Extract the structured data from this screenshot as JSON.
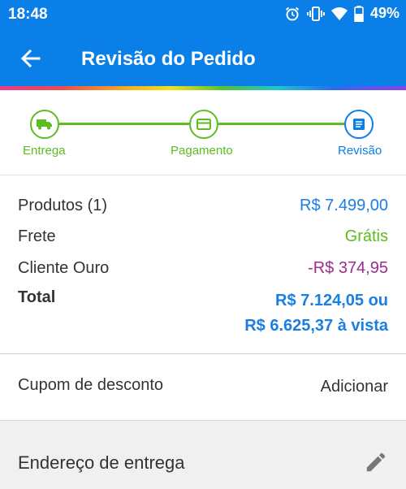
{
  "status_bar": {
    "time": "18:48",
    "battery": "49%",
    "icons": [
      "alarm-icon",
      "vibrate-icon",
      "wifi-icon",
      "battery-icon"
    ]
  },
  "app_bar": {
    "title": "Revisão do Pedido",
    "back_icon": "arrow-back-icon"
  },
  "colors": {
    "primary": "#0a7fe8",
    "step_done": "#5bbd1e",
    "discount": "#9c2c8f"
  },
  "stepper": {
    "steps": [
      {
        "label": "Entrega",
        "icon": "truck-icon",
        "state": "done"
      },
      {
        "label": "Pagamento",
        "icon": "card-icon",
        "state": "done"
      },
      {
        "label": "Revisão",
        "icon": "document-icon",
        "state": "current"
      }
    ]
  },
  "summary": {
    "products_label": "Produtos (1)",
    "products_value": "R$ 7.499,00",
    "shipping_label": "Frete",
    "shipping_value": "Grátis",
    "gold_label": "Cliente Ouro",
    "gold_value": "-R$ 374,95",
    "total_label": "Total",
    "total_installment": "R$ 7.124,05 ou",
    "total_cash": "R$ 6.625,37 à vista"
  },
  "coupon": {
    "label": "Cupom de desconto",
    "action": "Adicionar"
  },
  "address": {
    "title": "Endereço de entrega",
    "edit_icon": "pencil-icon"
  }
}
